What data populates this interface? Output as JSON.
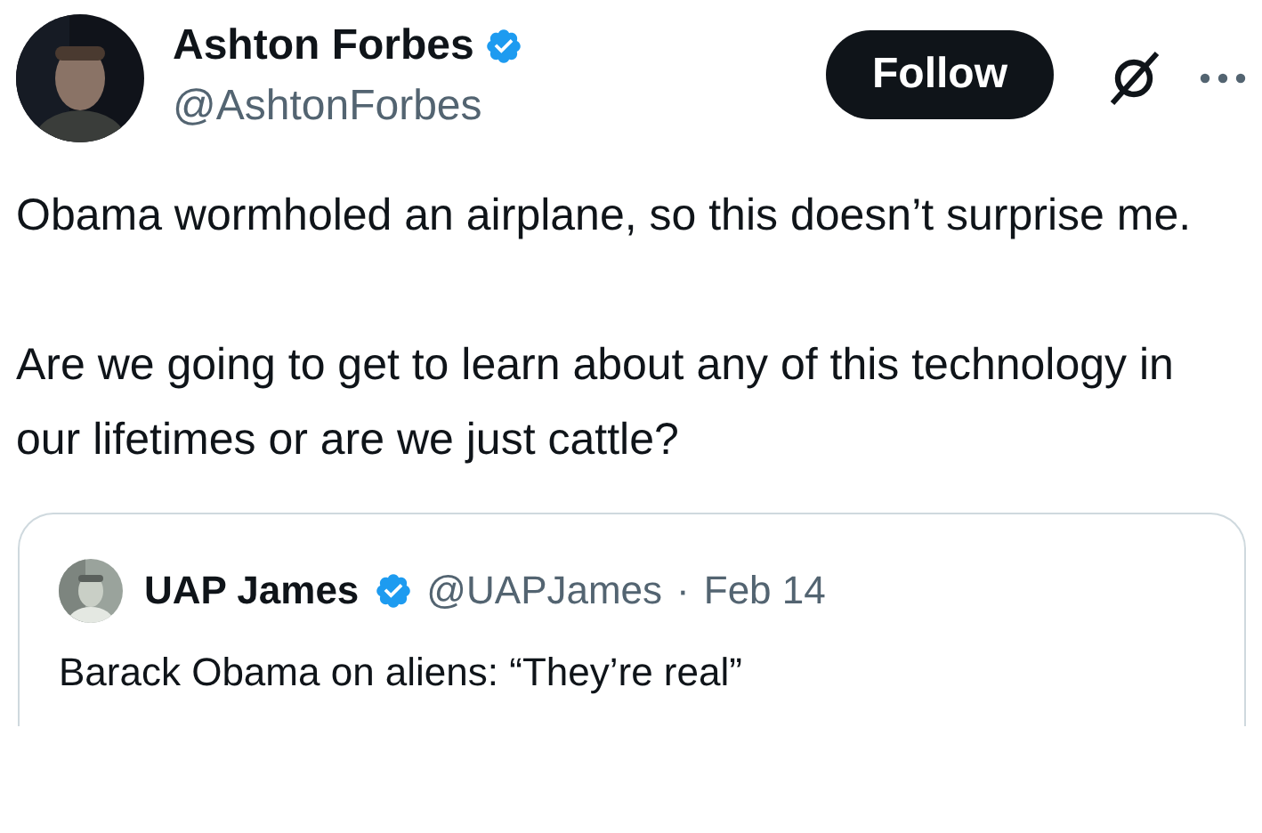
{
  "author": {
    "name": "Ashton Forbes",
    "verified": true,
    "handle": "@AshtonForbes"
  },
  "follow_button": {
    "label": "Follow"
  },
  "paragraphs": [
    "Obama wormholed an airplane, so this doesn’t surprise me.",
    "Are we going to get to learn about any of this technology in our lifetimes or are we just cattle?"
  ],
  "quoted_post": {
    "name": "UAP James",
    "verified": true,
    "handle": "@UAPJames",
    "separator": "·",
    "date": "Feb 14",
    "text": "Barack Obama on aliens: “They’re real”"
  }
}
